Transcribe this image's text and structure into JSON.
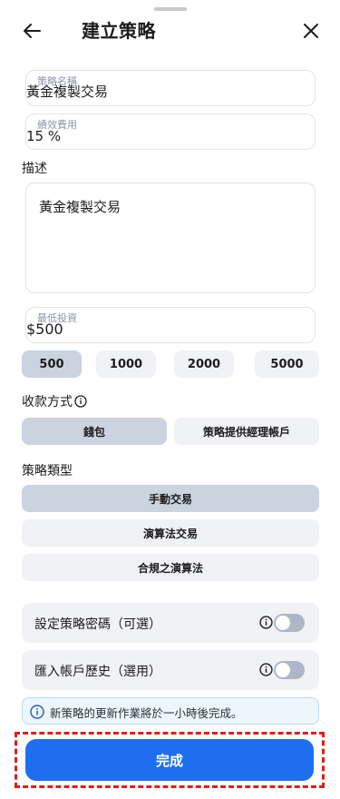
{
  "header": {
    "title": "建立策略"
  },
  "form": {
    "strategy_name": {
      "label": "策略名稱",
      "value": "黃金複製交易"
    },
    "performance_fee": {
      "label": "績效費用",
      "value": "15 %"
    },
    "description": {
      "label": "描述",
      "value": "黃金複製交易"
    },
    "min_investment": {
      "label": "最低投資",
      "value": "$500"
    },
    "amount_presets": [
      "500",
      "1000",
      "2000",
      "5000"
    ],
    "selected_amount": "500"
  },
  "payment": {
    "label": "收款方式",
    "options": [
      "錢包",
      "策略提供經理帳戶"
    ],
    "selected": "錢包"
  },
  "strategy_type": {
    "label": "策略類型",
    "options": [
      "手動交易",
      "演算法交易",
      "合規之演算法"
    ],
    "selected": "手動交易"
  },
  "toggles": {
    "password": {
      "label": "設定策略密碼（可選）",
      "on": false
    },
    "import_history": {
      "label": "匯入帳戶歷史（選用）",
      "on": false
    }
  },
  "notice": {
    "text": "新策略的更新作業將於一小時後完成。"
  },
  "cta": {
    "label": "完成"
  },
  "colors": {
    "primary": "#1e6ff0",
    "selected_chip": "#cbd3df",
    "highlight_border": "#e31b1b"
  }
}
